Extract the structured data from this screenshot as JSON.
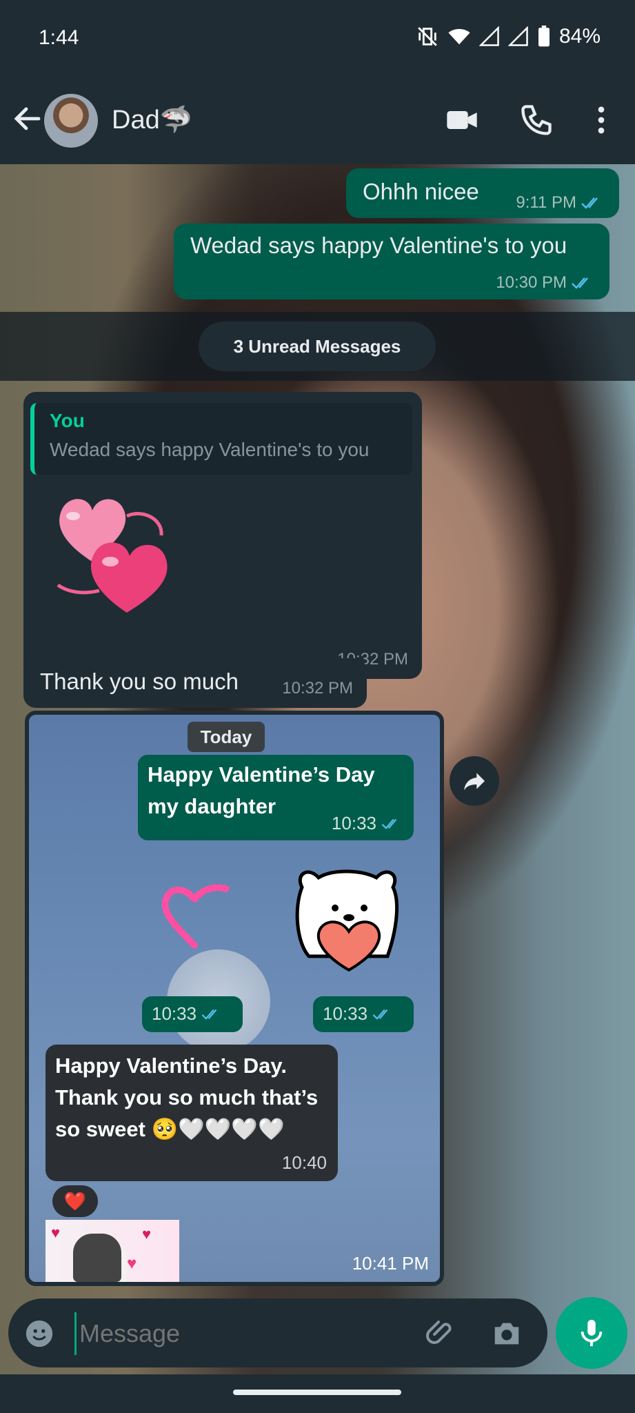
{
  "status_bar": {
    "time": "1:44",
    "battery": "84%"
  },
  "header": {
    "contact_name": "Dad🦈"
  },
  "messages": [
    {
      "text": "Ohhh nicee",
      "time": "9:11 PM"
    },
    {
      "text": "Wedad says happy Valentine's to you",
      "time": "10:30 PM"
    }
  ],
  "unread_label": "3 Unread Messages",
  "reply": {
    "quote_author": "You",
    "quote_text": "Wedad says happy Valentine's to you",
    "time": "10:32 PM"
  },
  "thanks": {
    "text": "Thank you so much",
    "time": "10:32 PM"
  },
  "shared_screenshot": {
    "date_chip": "Today",
    "msg1_line1": "Happy Valentine’s Day",
    "msg1_line2": "my daughter",
    "msg1_time": "10:33",
    "sticker1_time": "10:33",
    "sticker2_time": "10:33",
    "reply_line1": "Happy Valentine’s Day.",
    "reply_line2": "Thank you so much that’s",
    "reply_line3": "so sweet 🥺🤍🤍🤍🤍",
    "reply_time": "10:40",
    "reaction": "❤️",
    "time": "10:41 PM"
  },
  "composer": {
    "placeholder": "Message"
  },
  "colors": {
    "outgoing": "#005c4b",
    "incoming": "#1f2c34",
    "accent": "#00a884",
    "tick": "#53bdeb"
  }
}
